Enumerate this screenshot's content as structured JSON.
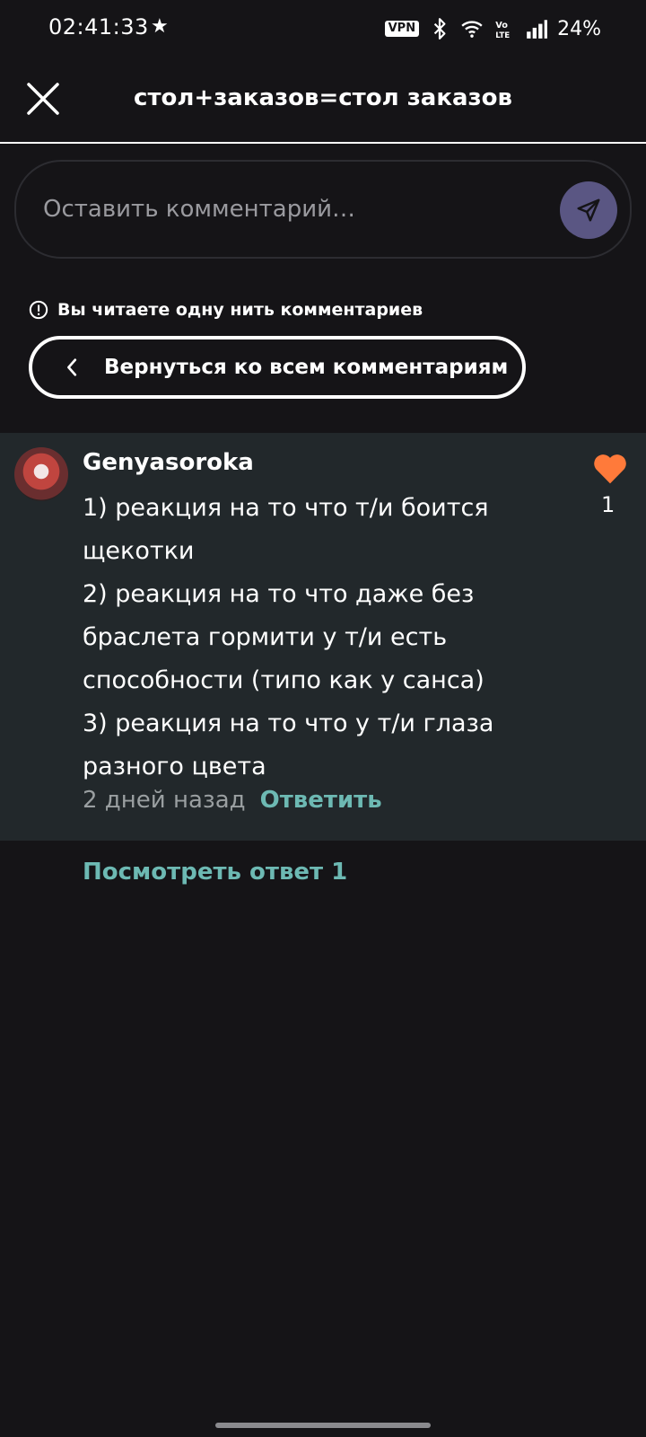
{
  "status_bar": {
    "time": "02:41:33",
    "vpn": "VPN",
    "battery": "24%"
  },
  "header": {
    "title": "стол+заказов=стол заказов"
  },
  "comment_input": {
    "placeholder": "Оставить комментарий…"
  },
  "thread_notice": "Вы читаете одну нить комментариев",
  "back_button": {
    "label": "Вернуться ко всем комментариям"
  },
  "comment": {
    "author": "Genyasoroka",
    "lines": [
      "1) реакция на то что т/и боится щекотки",
      "2) реакция на то что даже без браслета гормити у т/и есть способности (типо как у санса)",
      "3) реакция на то что у т/и глаза разного цвета"
    ],
    "time_ago": "2 дней назад",
    "reply_label": "Ответить",
    "likes": "1"
  },
  "view_replies": "Посмотреть ответ 1",
  "colors": {
    "background": "#151417",
    "comment_bg": "#22282b",
    "accent_teal": "#6db9b3",
    "heart": "#ff7a3a",
    "send_button": "#5a5683"
  }
}
